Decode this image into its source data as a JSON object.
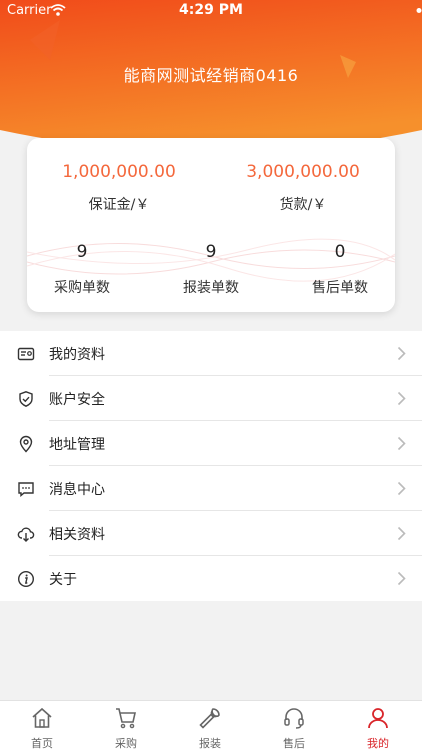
{
  "status_bar": {
    "carrier": "Carrier",
    "time": "4:29 PM"
  },
  "header": {
    "title": "能商网测试经销商0416"
  },
  "stats": {
    "deposit_value": "1,000,000.00",
    "deposit_label": "保证金/￥",
    "payment_value": "3,000,000.00",
    "payment_label": "货款/￥",
    "purchase_count": "9",
    "purchase_label": "采购单数",
    "install_count": "9",
    "install_label": "报装单数",
    "aftersale_count": "0",
    "aftersale_label": "售后单数"
  },
  "menu": {
    "items": [
      {
        "label": "我的资料",
        "icon": "id-card-icon"
      },
      {
        "label": "账户安全",
        "icon": "shield-icon"
      },
      {
        "label": "地址管理",
        "icon": "location-pin-icon"
      },
      {
        "label": "消息中心",
        "icon": "message-icon"
      },
      {
        "label": "相关资料",
        "icon": "cloud-download-icon"
      },
      {
        "label": "关于",
        "icon": "info-icon"
      }
    ]
  },
  "tabbar": {
    "active": "我的",
    "tabs": [
      {
        "label": "首页",
        "icon": "home-icon"
      },
      {
        "label": "采购",
        "icon": "cart-icon"
      },
      {
        "label": "报装",
        "icon": "wrench-icon"
      },
      {
        "label": "售后",
        "icon": "headset-icon"
      },
      {
        "label": "我的",
        "icon": "person-icon"
      }
    ]
  },
  "colors": {
    "accent": "#f4683c",
    "header_top": "#f14b1a",
    "header_bottom": "#f6902c",
    "tab_active": "#d9252a"
  }
}
